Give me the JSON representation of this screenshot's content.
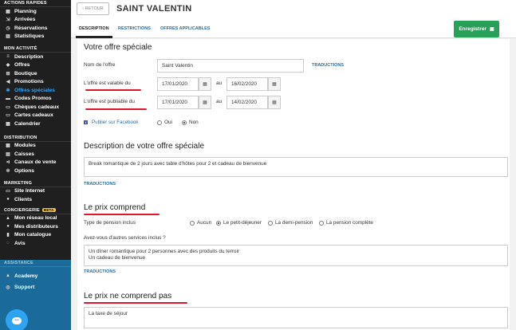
{
  "sidebar": {
    "sections": {
      "quick": "ACTIONS RAPIDES",
      "activity": "MON ACTIVITÉ",
      "distribution": "DISTRIBUTION",
      "marketing": "MARKETING",
      "concierge": "CONCIERGERIE",
      "concierge_badge": "Beta",
      "assistance": "ASSISTANCE"
    },
    "quick_items": [
      "Planning",
      "Arrivées",
      "Réservations",
      "Statistiques"
    ],
    "activity_items": [
      "Description",
      "Offres",
      "Boutique",
      "Promotions",
      "Offres spéciales",
      "Codes Promos",
      "Chèques cadeaux",
      "Cartes cadeaux",
      "Calendrier"
    ],
    "distribution_items": [
      "Modules",
      "Caisses",
      "Canaux de vente",
      "Options"
    ],
    "marketing_items": [
      "Site Internet",
      "Clients"
    ],
    "concierge_items": [
      "Mon réseau local",
      "Mes distributeurs",
      "Mon catalogue",
      "Avis"
    ],
    "assistance_items": [
      "Academy",
      "Support"
    ]
  },
  "header": {
    "back_label": "‹ RETOUR",
    "title": "SAINT VALENTIN",
    "tabs": [
      "DESCRIPTION",
      "RESTRICTIONS",
      "OFFRES APPLICABLES"
    ],
    "save_label": "Enregistrer"
  },
  "form": {
    "section_title": "Votre offre spéciale",
    "name_label": "Nom de l'offre",
    "name_value": "Saint Valentin",
    "translations_link": "TRADUCTIONS",
    "valid_label": "L'offre est valable du",
    "valid_from": "17/01/2020",
    "valid_to": "16/02/2020",
    "published_label": "L'offre est publiable du",
    "published_from": "17/01/2020",
    "published_to": "14/02/2020",
    "to_word": "au",
    "facebook_label": "Publier sur Facebook",
    "facebook_yes": "Oui",
    "facebook_no": "Non",
    "description_title": "Description de votre offre spéciale",
    "description_value": "Break romantique de 2 jours avec table d'hôtes pour 2 et cadeau de bienvenue",
    "includes_title": "Le prix comprend",
    "pension_label": "Type de pension inclus",
    "pension_options": [
      "Aucun",
      "Le petit-déjeuner",
      "La demi-pension",
      "La pension complète"
    ],
    "other_services_label": "Avez-vous d'autres services inclus ?",
    "other_services_line1": "Un dîner romantique pour 2 personnes avec des produits du terroir",
    "other_services_line2": "Un cadeau de bienvenue",
    "excludes_title": "Le prix ne comprend pas",
    "excludes_value": "La taxe de séjour"
  },
  "colors": {
    "sidebar_bg": "#1f1f1f",
    "active": "#2ea3f2",
    "save": "#27a05a",
    "annotation": "#e0162b"
  }
}
